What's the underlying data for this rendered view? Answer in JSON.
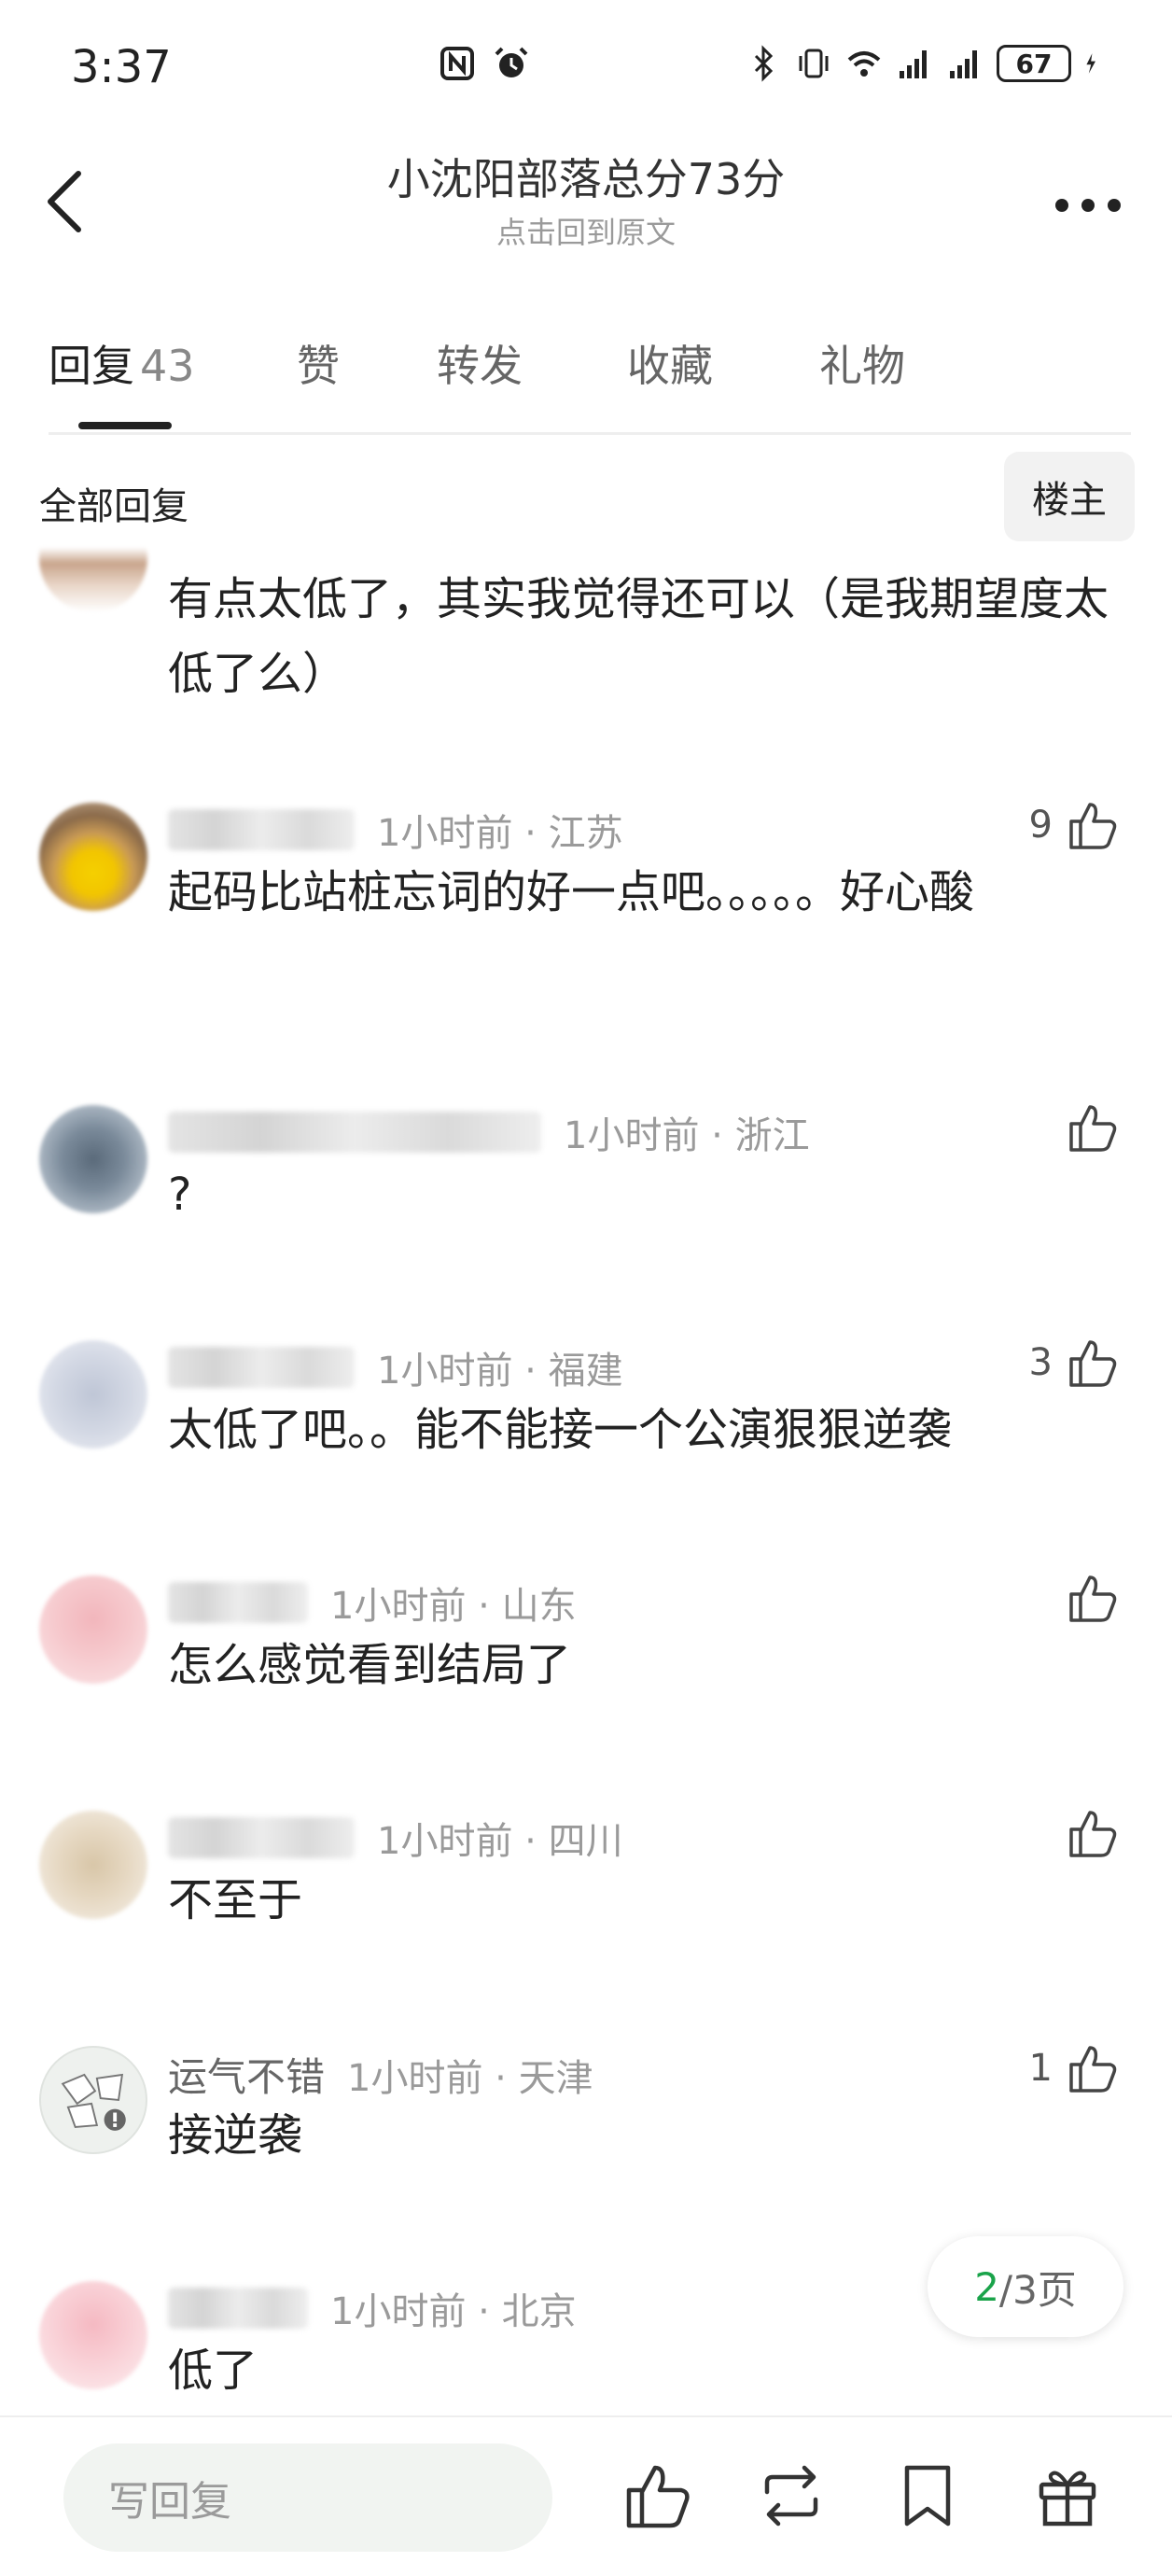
{
  "status_bar": {
    "time": "3:37",
    "battery": "67",
    "icons": [
      "nfc-icon",
      "alarm-icon",
      "bluetooth-icon",
      "vibrate-icon",
      "wifi-icon",
      "signal-icon",
      "signal-icon",
      "charging-icon"
    ]
  },
  "header": {
    "title": "小沈阳部落总分73分",
    "subtitle": "点击回到原文"
  },
  "tabs": [
    {
      "label": "回复",
      "count": "43",
      "active": true
    },
    {
      "label": "赞"
    },
    {
      "label": "转发"
    },
    {
      "label": "收藏"
    },
    {
      "label": "礼物"
    }
  ],
  "filter": {
    "label": "全部回复",
    "button": "楼主"
  },
  "comments": [
    {
      "nickname": "",
      "time": "",
      "location": "",
      "likes": "",
      "content": "有点太低了，其实我觉得还可以（是我期望度太低了么）"
    },
    {
      "nickname": "",
      "time": "1小时前",
      "location": "江苏",
      "likes": "9",
      "content": "起码比站桩忘词的好一点吧。。。。。好心酸"
    },
    {
      "nickname": "",
      "time": "1小时前",
      "location": "浙江",
      "likes": "",
      "content": "?"
    },
    {
      "nickname": "",
      "time": "1小时前",
      "location": "福建",
      "likes": "3",
      "content": "太低了吧。。能不能接一个公演狠狠逆袭"
    },
    {
      "nickname": "",
      "time": "1小时前",
      "location": "山东",
      "likes": "",
      "content": "怎么感觉看到结局了"
    },
    {
      "nickname": "",
      "time": "1小时前",
      "location": "四川",
      "likes": "",
      "content": "不至于"
    },
    {
      "nickname": "运气不错",
      "time": "1小时前",
      "location": "天津",
      "likes": "1",
      "content": "接逆袭"
    },
    {
      "nickname": "",
      "time": "1小时前",
      "location": "北京",
      "likes": "",
      "content": "低了"
    }
  ],
  "pagination": {
    "current": "2",
    "total_text": "/3页"
  },
  "bottom_bar": {
    "reply_placeholder": "写回复",
    "icons": [
      "like-icon",
      "repost-icon",
      "bookmark-icon",
      "gift-icon"
    ]
  }
}
